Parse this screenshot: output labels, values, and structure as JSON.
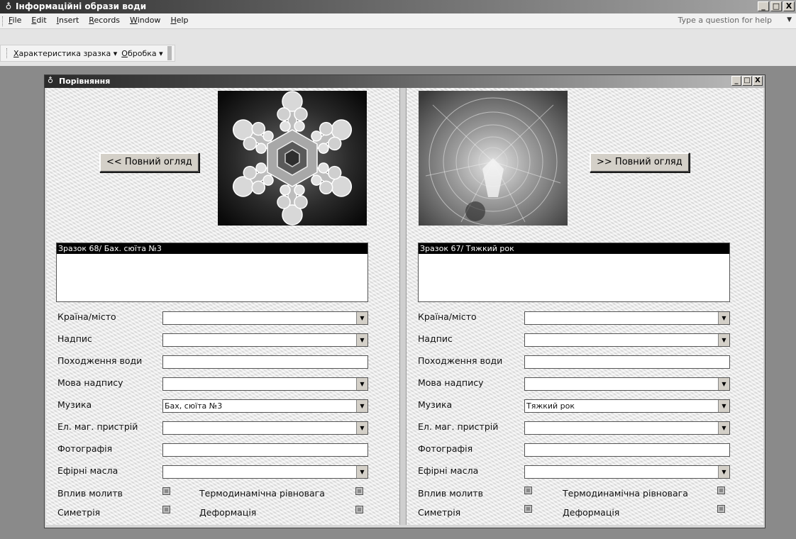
{
  "app": {
    "title": "Інформаційні образи води",
    "controls": {
      "minimize": "_",
      "maximize": "□",
      "close": "X"
    }
  },
  "menubar": {
    "items": [
      "File",
      "Edit",
      "Insert",
      "Records",
      "Window",
      "Help"
    ],
    "help_placeholder": "Type a question for help",
    "help_arrow": "▼"
  },
  "toolbar": {
    "menus": [
      "Характеристика зразка ▾",
      "Обробка ▾"
    ]
  },
  "child_window": {
    "title": "Порівняння",
    "controls": {
      "minimize": "_",
      "maximize": "□",
      "close": "X"
    }
  },
  "left": {
    "button": "<< Повний огляд",
    "list_selected": "Зразок 68/ Бах. сюїта №3",
    "fields": {
      "country": {
        "label": "Країна/місто",
        "value": ""
      },
      "inscription": {
        "label": "Надпис",
        "value": ""
      },
      "water_origin": {
        "label": "Походження води",
        "value": ""
      },
      "language": {
        "label": "Мова надпису",
        "value": ""
      },
      "music": {
        "label": "Музика",
        "value": "Бах, сюїта №3"
      },
      "device": {
        "label": "Ел. маг. пристрій",
        "value": ""
      },
      "photo": {
        "label": "Фотографія",
        "value": ""
      },
      "oils": {
        "label": "Ефірні масла",
        "value": ""
      }
    },
    "checks": {
      "prayer": "Вплив молитв",
      "thermo": "Термодинамічна рівновага",
      "symmetry": "Симетрія",
      "deformation": "Деформація"
    }
  },
  "right": {
    "button": ">> Повний огляд",
    "list_selected": "Зразок 67/ Тяжкий рок",
    "fields": {
      "country": {
        "label": "Країна/місто",
        "value": ""
      },
      "inscription": {
        "label": "Надпис",
        "value": ""
      },
      "water_origin": {
        "label": "Походження води",
        "value": ""
      },
      "language": {
        "label": "Мова надпису",
        "value": ""
      },
      "music": {
        "label": "Музика",
        "value": "Тяжкий рок"
      },
      "device": {
        "label": "Ел. маг. пристрій",
        "value": ""
      },
      "photo": {
        "label": "Фотографія",
        "value": ""
      },
      "oils": {
        "label": "Ефірні масла",
        "value": ""
      }
    },
    "checks": {
      "prayer": "Вплив молитв",
      "thermo": "Термодинамічна рівновага",
      "symmetry": "Симетрія",
      "deformation": "Деформація"
    }
  }
}
